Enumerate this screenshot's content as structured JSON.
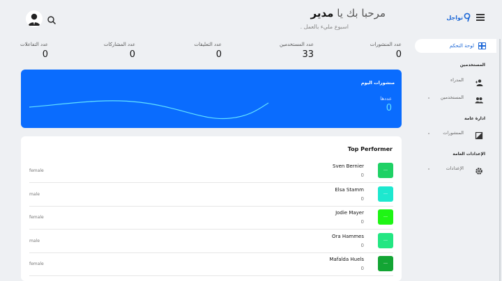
{
  "header": {
    "greeting_prefix": "مرحبا بك يا",
    "greeting_name": "مدير",
    "subtitle": "اسبوع مليء بالعمل .",
    "logo_text": "تواجل"
  },
  "icons": {
    "avatar": "user-avatar-icon",
    "search": "search-icon",
    "menu": "hamburger-menu-icon",
    "dashboard": "dashboard-grid-icon",
    "admins": "person-add-icon",
    "users": "people-icon",
    "posts": "post-icon",
    "settings": "gear-icon"
  },
  "sidebar": {
    "active_item": "لوحة التحكم",
    "sections": [
      {
        "title": "المستخدمين",
        "items": [
          "المدراء",
          "المستخدمين"
        ]
      },
      {
        "title": "ادارة عامة",
        "items": [
          "المنشورات"
        ]
      },
      {
        "title": "الإعدادات العامة",
        "items": [
          "الإعدادات"
        ]
      }
    ]
  },
  "stats": [
    {
      "label": "عدد المنشورات",
      "value": "0"
    },
    {
      "label": "عدد المستخدمين",
      "value": "33"
    },
    {
      "label": "عدد التعليقات",
      "value": "0"
    },
    {
      "label": "عدد المشاركات",
      "value": "0"
    },
    {
      "label": "عدد التفاعلات",
      "value": "0"
    }
  ],
  "today_card": {
    "title": "منشورات اليوم",
    "count_label": "عددها",
    "count_value": "0"
  },
  "top_performer": {
    "title": "Top Performer",
    "rows": [
      {
        "name": "Sven Bernier",
        "score": "0",
        "gender": "female",
        "color": "#1fd165"
      },
      {
        "name": "Elsa Stamm",
        "score": "0",
        "gender": "male",
        "color": "#1de8cf"
      },
      {
        "name": "Jodie Mayer",
        "score": "0",
        "gender": "female",
        "color": "#1ef514"
      },
      {
        "name": "Ora Hammes",
        "score": "0",
        "gender": "male",
        "color": "#23e682"
      },
      {
        "name": "Mafalda Huels",
        "score": "0",
        "gender": "female",
        "color": "#13a534"
      }
    ]
  },
  "colors": {
    "accent": "#0a6cfe",
    "sidebar_active": "#1a66d6",
    "chart_line": "#62e2ff"
  }
}
